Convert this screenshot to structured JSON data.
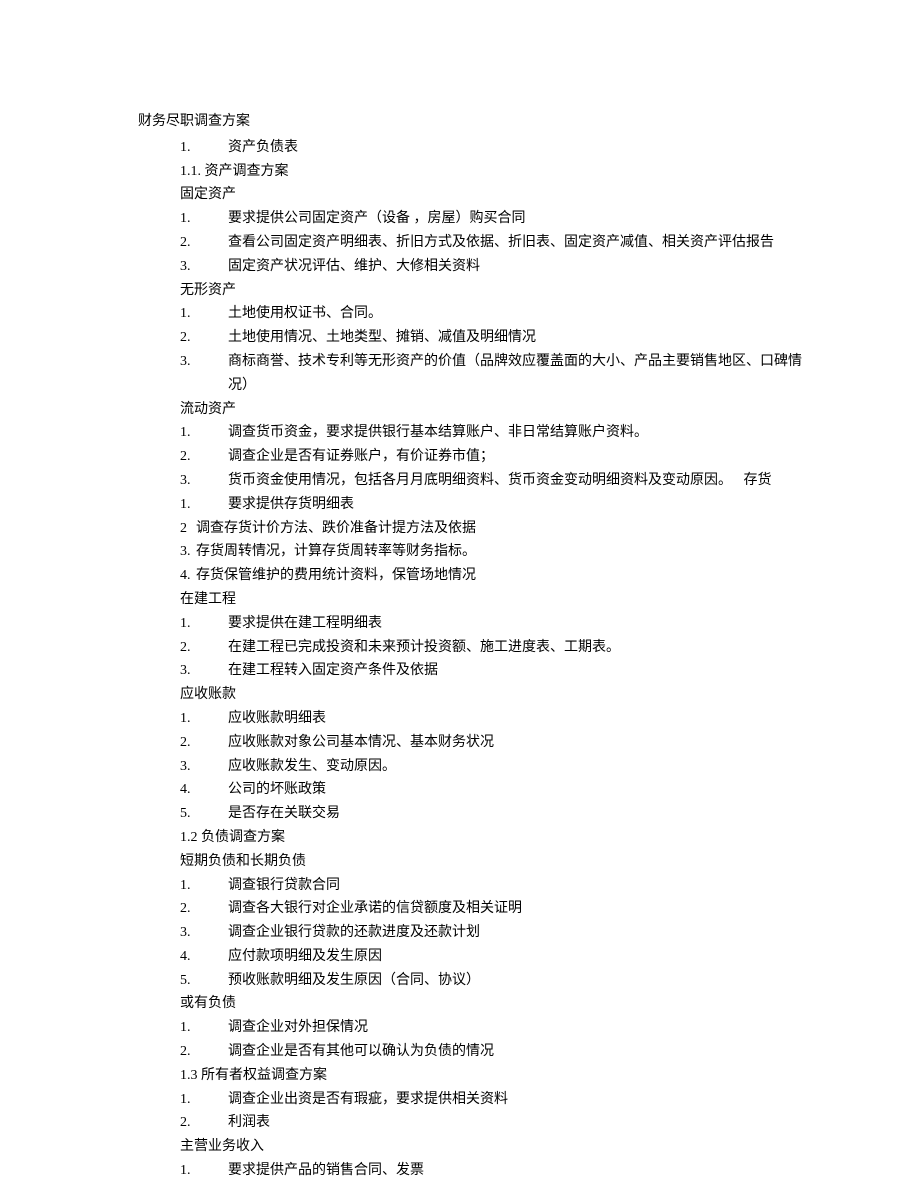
{
  "title": "财务尽职调查方案",
  "sections": {
    "s1": {
      "num": "1.",
      "label": "资产负债表"
    },
    "s1_1": {
      "label": "1.1. 资产调查方案"
    },
    "fixed_assets": {
      "heading": "固定资产",
      "items": [
        {
          "num": "1.",
          "text": "要求提供公司固定资产（设备 ，房屋）购买合同"
        },
        {
          "num": "2.",
          "text": "查看公司固定资产明细表、折旧方式及依据、折旧表、固定资产减值、相关资产评估报告"
        },
        {
          "num": "3.",
          "text": "固定资产状况评估、维护、大修相关资料"
        }
      ]
    },
    "intangible_assets": {
      "heading": "无形资产",
      "items": [
        {
          "num": "1.",
          "text": "土地使用权证书、合同。"
        },
        {
          "num": "2.",
          "text": "土地使用情况、土地类型、摊销、减值及明细情况"
        },
        {
          "num": "3.",
          "text": "商标商誉、技术专利等无形资产的价值（品牌效应覆盖面的大小、产品主要销售地区、口碑情况）"
        }
      ]
    },
    "current_assets": {
      "heading": "流动资产",
      "items": [
        {
          "num": "1.",
          "text": "调查货币资金，要求提供银行基本结算账户、非日常结算账户资料。"
        },
        {
          "num": "2.",
          "text": "调查企业是否有证券账户，有价证券市值；"
        },
        {
          "num": "3.",
          "text": "货币资金使用情况，包括各月月底明细资料、货币资金变动明细资料及变动原因。",
          "suffix": "存货"
        }
      ],
      "inventory_items": [
        {
          "num": "1.",
          "text": "要求提供存货明细表"
        },
        {
          "num": "2",
          "text": "调查存货计价方法、跌价准备计提方法及依据"
        },
        {
          "num": "3.",
          "text": "存货周转情况，计算存货周转率等财务指标。"
        },
        {
          "num": "4.",
          "text": "存货保管维护的费用统计资料，保管场地情况"
        }
      ]
    },
    "construction": {
      "heading": "在建工程",
      "items": [
        {
          "num": "1.",
          "text": "要求提供在建工程明细表"
        },
        {
          "num": "2.",
          "text": "在建工程已完成投资和未来预计投资额、施工进度表、工期表。"
        },
        {
          "num": "3.",
          "text": "在建工程转入固定资产条件及依据"
        }
      ]
    },
    "receivables": {
      "heading": "应收账款",
      "items": [
        {
          "num": "1.",
          "text": "应收账款明细表"
        },
        {
          "num": "2.",
          "text": "应收账款对象公司基本情况、基本财务状况"
        },
        {
          "num": "3.",
          "text": "应收账款发生、变动原因。"
        },
        {
          "num": "4.",
          "text": "公司的坏账政策"
        },
        {
          "num": "5.",
          "text": "是否存在关联交易"
        }
      ]
    },
    "s1_2": {
      "label": "1.2 负债调查方案"
    },
    "debt": {
      "heading": "短期负债和长期负债",
      "items": [
        {
          "num": "1.",
          "text": "调查银行贷款合同"
        },
        {
          "num": "2.",
          "text": "调查各大银行对企业承诺的信贷额度及相关证明"
        },
        {
          "num": "3.",
          "text": "调查企业银行贷款的还款进度及还款计划"
        },
        {
          "num": "4.",
          "text": "应付款项明细及发生原因"
        },
        {
          "num": "5.",
          "text": "预收账款明细及发生原因（合同、协议）"
        }
      ]
    },
    "contingent": {
      "heading": "或有负债",
      "items": [
        {
          "num": "1.",
          "text": "调查企业对外担保情况"
        },
        {
          "num": "2.",
          "text": "调查企业是否有其他可以确认为负债的情况"
        }
      ]
    },
    "s1_3": {
      "label": "1.3 所有者权益调查方案"
    },
    "equity": {
      "items": [
        {
          "num": "1.",
          "text": "调查企业出资是否有瑕疵，要求提供相关资料"
        },
        {
          "num": "2.",
          "text": "利润表"
        }
      ]
    },
    "revenue": {
      "heading": "主营业务收入",
      "items": [
        {
          "num": "1.",
          "text": "要求提供产品的销售合同、发票"
        }
      ]
    }
  }
}
